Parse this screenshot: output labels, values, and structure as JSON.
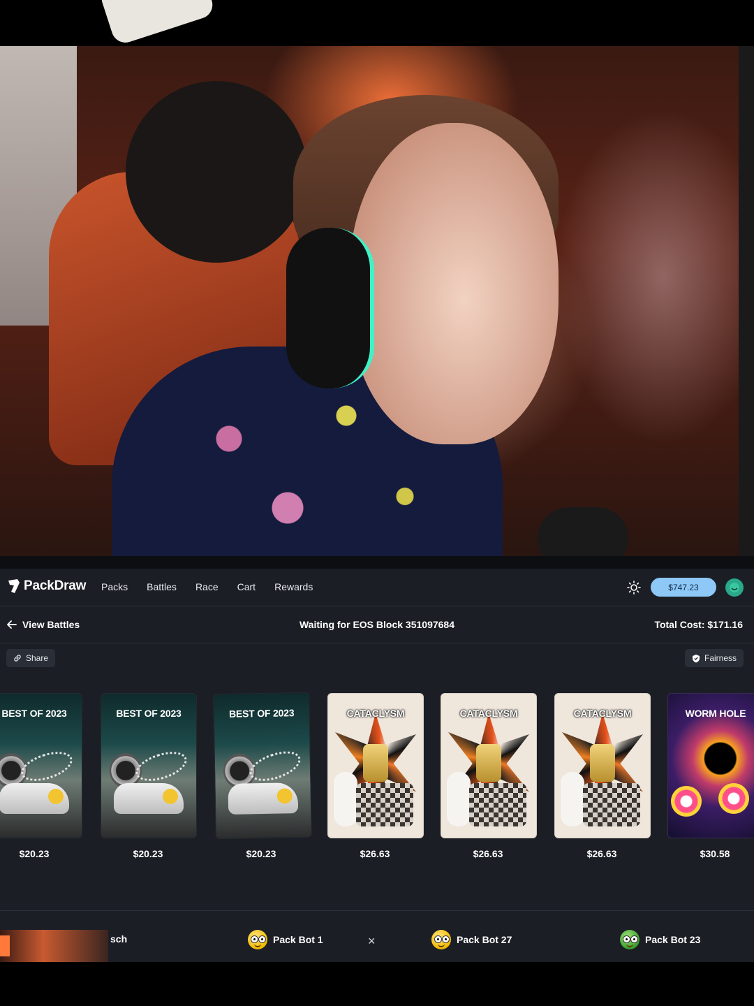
{
  "app": {
    "brand": "PackDraw",
    "nav": [
      "Packs",
      "Battles",
      "Race",
      "Cart",
      "Rewards"
    ],
    "balance": "$747.23"
  },
  "battle": {
    "back_label": "View Battles",
    "status": "Waiting for EOS Block 351097684",
    "total_cost": "Total Cost: $171.16",
    "share_label": "Share",
    "fairness_label": "Fairness"
  },
  "packs": [
    {
      "name": "BEST OF 2023",
      "price": "$20.23",
      "theme": "best"
    },
    {
      "name": "BEST OF 2023",
      "price": "$20.23",
      "theme": "best"
    },
    {
      "name": "BEST OF 2023",
      "price": "$20.23",
      "theme": "best"
    },
    {
      "name": "CATACLYSM",
      "price": "$26.63",
      "theme": "cataclysm"
    },
    {
      "name": "CATACLYSM",
      "price": "$26.63",
      "theme": "cataclysm"
    },
    {
      "name": "CATACLYSM",
      "price": "$26.63",
      "theme": "cataclysm"
    },
    {
      "name": "WORM HOLE",
      "price": "$30.58",
      "theme": "wormhole"
    }
  ],
  "players": {
    "fragment": "sch",
    "list": [
      {
        "name": "Pack Bot 1",
        "avatar": "yellow-face-icon"
      },
      {
        "name": "Pack Bot 27",
        "avatar": "yellow-face-icon"
      },
      {
        "name": "Pack Bot 23",
        "avatar": "green-face-icon"
      }
    ],
    "separator": "×"
  },
  "colors": {
    "background": "#1b1f25",
    "balance_pill": "#8ec8f7",
    "pill": "#2a2f37"
  }
}
